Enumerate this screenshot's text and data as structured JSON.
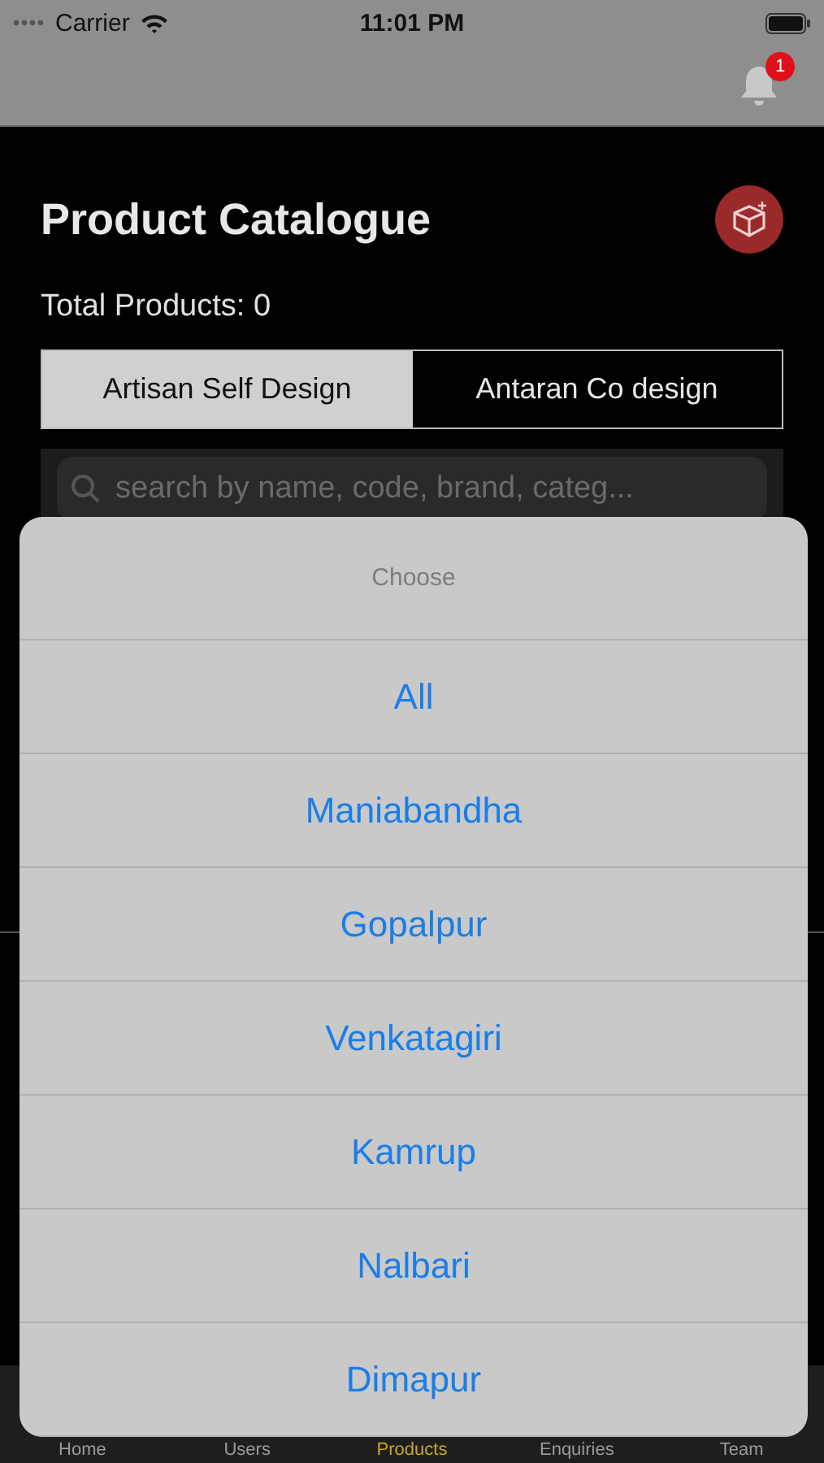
{
  "status_bar": {
    "carrier": "Carrier",
    "time": "11:01 PM"
  },
  "nav_bar": {
    "notification_badge": "1"
  },
  "header": {
    "title": "Product Catalogue",
    "total": "Total Products: 0"
  },
  "segments": [
    {
      "label": "Artisan Self Design",
      "selected": true
    },
    {
      "label": "Antaran Co design",
      "selected": false
    }
  ],
  "search": {
    "placeholder": "search by name, code, brand, categ..."
  },
  "tab_bar": [
    {
      "label": "Home",
      "selected": false
    },
    {
      "label": "Users",
      "selected": false
    },
    {
      "label": "Products",
      "selected": true
    },
    {
      "label": "Enquiries",
      "selected": false
    },
    {
      "label": "Team",
      "selected": false
    }
  ],
  "action_sheet": {
    "title": "Choose",
    "options": [
      "All",
      "Maniabandha",
      "Gopalpur",
      "Venkatagiri",
      "Kamrup",
      "Nalbari",
      "Dimapur"
    ]
  }
}
